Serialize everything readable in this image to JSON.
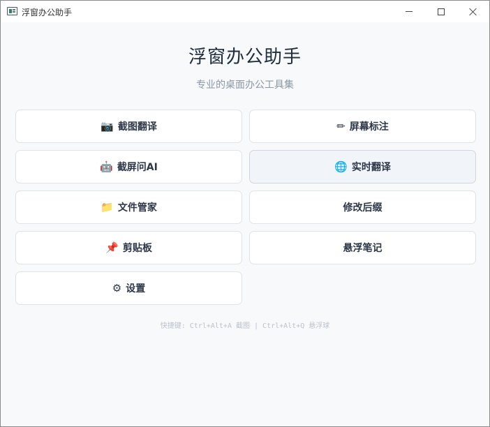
{
  "window": {
    "title": "浮窗办公助手"
  },
  "main": {
    "heading": "浮窗办公助手",
    "subtitle": "专业的桌面办公工具集"
  },
  "buttons": [
    {
      "icon": "📷",
      "icon_name": "camera-icon",
      "label": "截图翻译"
    },
    {
      "icon": "✏",
      "icon_name": "pencil-icon",
      "label": "屏幕标注"
    },
    {
      "icon": "🤖",
      "icon_name": "robot-icon",
      "label": "截屏问AI"
    },
    {
      "icon": "🌐",
      "icon_name": "globe-icon",
      "label": "实时翻译"
    },
    {
      "icon": "📁",
      "icon_name": "folder-icon",
      "label": "文件管家"
    },
    {
      "icon": "",
      "icon_name": "",
      "label": "修改后缀"
    },
    {
      "icon": "📌",
      "icon_name": "pushpin-icon",
      "label": "剪贴板"
    },
    {
      "icon": "",
      "icon_name": "",
      "label": "悬浮笔记"
    },
    {
      "icon": "⚙",
      "icon_name": "gear-icon",
      "label": "设置"
    }
  ],
  "footer": {
    "shortcuts": "快捷键: Ctrl+Alt+A 截图 | Ctrl+Alt+Q 悬浮球"
  },
  "colors": {
    "background": "#f8f9fb",
    "heading": "#1f2d3d",
    "subtitle": "#8b97a8",
    "button_border": "#dfe3ea",
    "active_button": "#f1f4f9"
  }
}
